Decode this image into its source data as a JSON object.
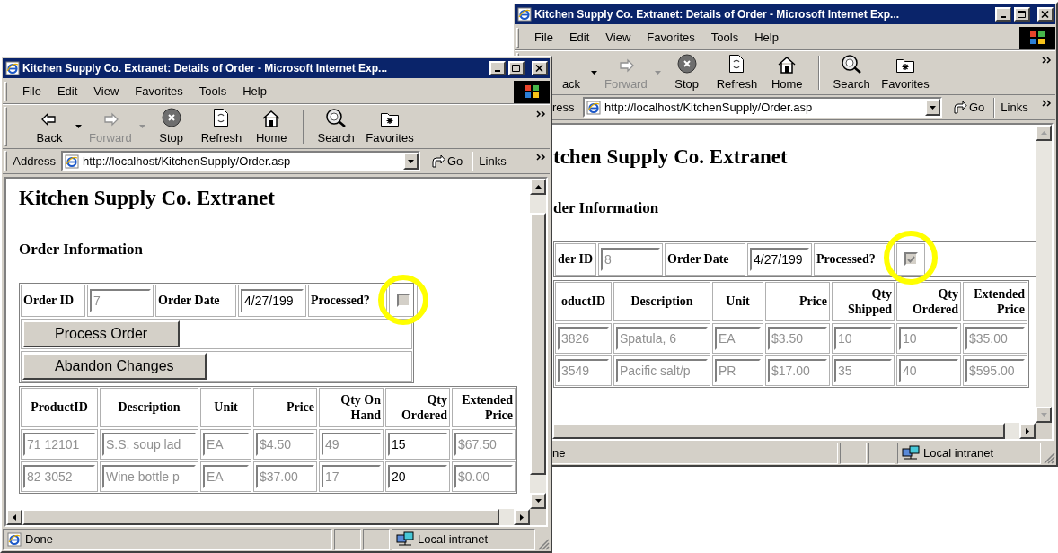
{
  "windows": [
    {
      "title": "Kitchen Supply Co. Extranet: Details of Order - Microsoft Internet Exp...",
      "menu": [
        "File",
        "Edit",
        "View",
        "Favorites",
        "Tools",
        "Help"
      ],
      "toolbar": [
        {
          "kind": "back",
          "label": "ack",
          "disabled": false
        },
        {
          "kind": "forward",
          "label": "Forward",
          "disabled": true
        },
        {
          "kind": "stop",
          "label": "Stop",
          "disabled": false
        },
        {
          "kind": "refresh",
          "label": "Refresh",
          "disabled": false
        },
        {
          "kind": "home",
          "label": "Home",
          "disabled": false
        },
        {
          "kind": "search",
          "label": "Search",
          "disabled": false
        },
        {
          "kind": "favorites",
          "label": "Favorites",
          "disabled": false
        }
      ],
      "address": {
        "label": "ress",
        "url": "http://localhost/KitchenSupply/Order.asp",
        "go": "Go",
        "links": "Links"
      },
      "page": {
        "heading": "tchen Supply Co. Extranet",
        "subheading": "der Information",
        "order": {
          "id_label": "der ID",
          "id": {
            "value": "8",
            "disabled": true
          },
          "date_label": "Order Date",
          "date": {
            "value": "4/27/199",
            "disabled": false
          },
          "processed_label": "Processed?",
          "processed": {
            "checked": true,
            "disabled": true
          }
        },
        "columns": [
          "oductID",
          "Description",
          "Unit",
          "Price",
          "Qty Shipped",
          "Qty Ordered",
          "Extended Price"
        ],
        "rows": [
          {
            "cells": [
              {
                "value": "3826",
                "disabled": true
              },
              {
                "value": "Spatula, 6",
                "disabled": true
              },
              {
                "value": "EA",
                "disabled": true
              },
              {
                "value": "$3.50",
                "disabled": true
              },
              {
                "value": "10",
                "disabled": true
              },
              {
                "value": "10",
                "disabled": true
              },
              {
                "value": "$35.00",
                "disabled": true
              }
            ]
          },
          {
            "cells": [
              {
                "value": "3549",
                "disabled": true
              },
              {
                "value": "Pacific salt/p",
                "disabled": true
              },
              {
                "value": "PR",
                "disabled": true
              },
              {
                "value": "$17.00",
                "disabled": true
              },
              {
                "value": "35",
                "disabled": true
              },
              {
                "value": "40",
                "disabled": true
              },
              {
                "value": "$595.00",
                "disabled": true
              }
            ]
          }
        ]
      },
      "status": {
        "text": "ne",
        "zone": "Local intranet"
      }
    },
    {
      "title": "Kitchen Supply Co. Extranet: Details of Order - Microsoft Internet Exp...",
      "menu": [
        "File",
        "Edit",
        "View",
        "Favorites",
        "Tools",
        "Help"
      ],
      "toolbar": [
        {
          "kind": "back",
          "label": "Back",
          "disabled": false
        },
        {
          "kind": "forward",
          "label": "Forward",
          "disabled": true
        },
        {
          "kind": "stop",
          "label": "Stop",
          "disabled": false
        },
        {
          "kind": "refresh",
          "label": "Refresh",
          "disabled": false
        },
        {
          "kind": "home",
          "label": "Home",
          "disabled": false
        },
        {
          "kind": "search",
          "label": "Search",
          "disabled": false
        },
        {
          "kind": "favorites",
          "label": "Favorites",
          "disabled": false
        }
      ],
      "address": {
        "label": "Address",
        "url": "http://localhost/KitchenSupply/Order.asp",
        "go": "Go",
        "links": "Links"
      },
      "page": {
        "heading": "Kitchen Supply Co. Extranet",
        "subheading": "Order Information",
        "order": {
          "id_label": "Order ID",
          "id": {
            "value": "7",
            "disabled": true
          },
          "date_label": "Order Date",
          "date": {
            "value": "4/27/199",
            "disabled": false
          },
          "processed_label": "Processed?",
          "processed": {
            "checked": false,
            "disabled": true
          }
        },
        "buttons": [
          "Process Order",
          "Abandon Changes"
        ],
        "columns": [
          "ProductID",
          "Description",
          "Unit",
          "Price",
          "Qty On Hand",
          "Qty Ordered",
          "Extended Price"
        ],
        "rows": [
          {
            "cells": [
              {
                "value": "71 12101",
                "disabled": true
              },
              {
                "value": "S.S. soup lad",
                "disabled": true
              },
              {
                "value": "EA",
                "disabled": true
              },
              {
                "value": "$4.50",
                "disabled": true
              },
              {
                "value": "49",
                "disabled": true
              },
              {
                "value": "15",
                "disabled": false
              },
              {
                "value": "$67.50",
                "disabled": true
              }
            ]
          },
          {
            "cells": [
              {
                "value": "82 3052",
                "disabled": true
              },
              {
                "value": "Wine bottle p",
                "disabled": true
              },
              {
                "value": "EA",
                "disabled": true
              },
              {
                "value": "$37.00",
                "disabled": true
              },
              {
                "value": "17",
                "disabled": true
              },
              {
                "value": "20",
                "disabled": false
              },
              {
                "value": "$0.00",
                "disabled": true
              }
            ]
          }
        ]
      },
      "status": {
        "text": "Done",
        "zone": "Local intranet"
      }
    }
  ]
}
